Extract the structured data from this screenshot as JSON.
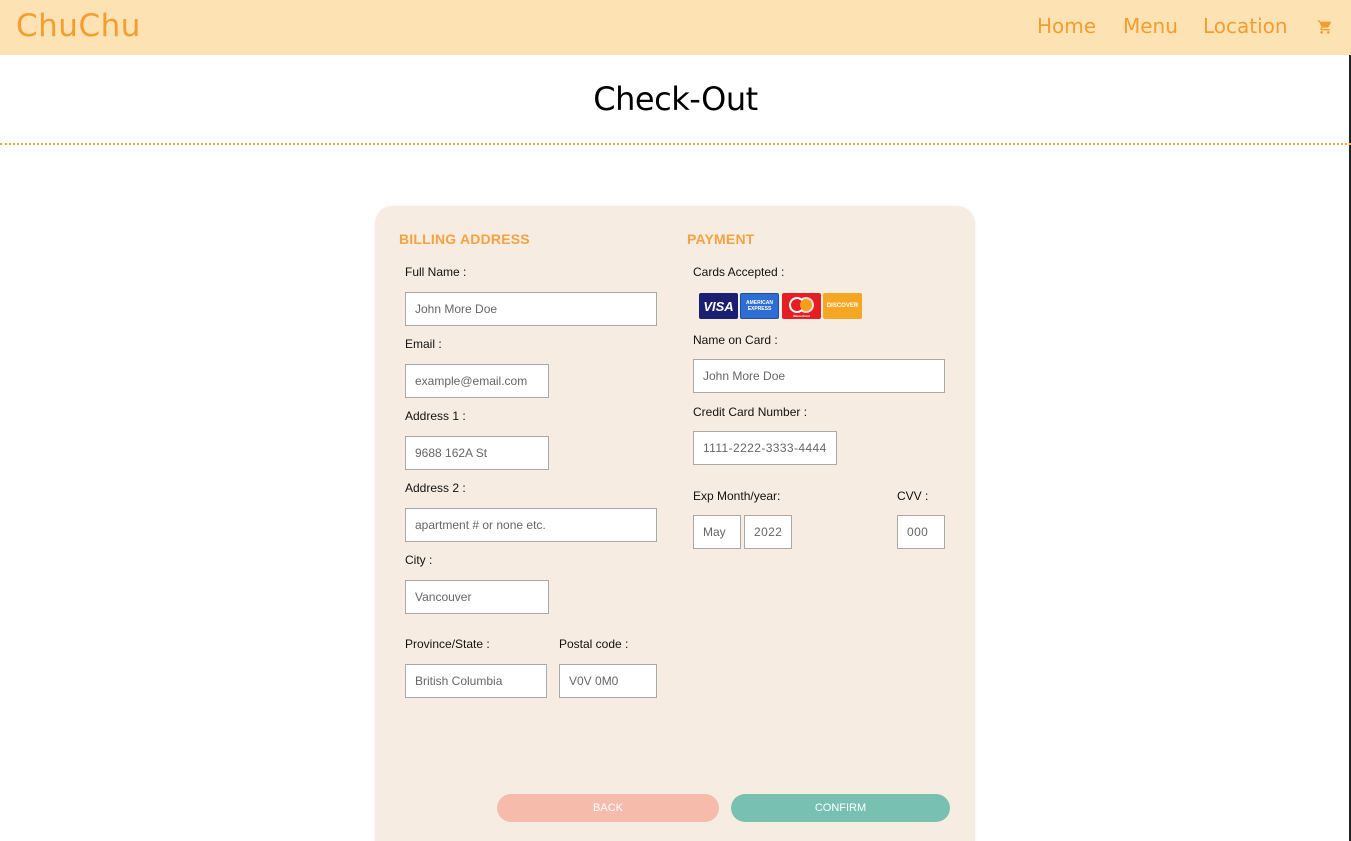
{
  "brand": {
    "name": "ChuChu",
    "color": "#f59d2e"
  },
  "nav": {
    "items": [
      "Home",
      "Menu",
      "Location"
    ],
    "cart_icon": "shopping-cart-icon",
    "background": "#fde3b3"
  },
  "page": {
    "title": "Check-Out"
  },
  "billing": {
    "heading": "BILLING ADDRESS",
    "full_name_label": "Full Name :",
    "full_name_placeholder": "John More Doe",
    "email_label": "Email :",
    "email_placeholder": "example@email.com",
    "address1_label": "Address 1 :",
    "address1_placeholder": "9688 162A St",
    "address2_label": "Address 2 :",
    "address2_placeholder": "apartment # or none etc.",
    "city_label": "City :",
    "city_placeholder": "Vancouver",
    "province_label": "Province/State :",
    "province_placeholder": "British Columbia",
    "postal_label": "Postal code :",
    "postal_placeholder": "V0V 0M0"
  },
  "payment": {
    "heading": "PAYMENT",
    "cards_label": "Cards Accepted :",
    "cards": [
      "VISA",
      "AMERICAN EXPRESS",
      "MasterCard",
      "DISCOVER"
    ],
    "name_label": "Name on Card :",
    "name_placeholder": "John More Doe",
    "card_number_label": "Credit Card Number :",
    "card_number_placeholder": "1111-2222-3333-4444",
    "exp_label": "Exp Month/year:",
    "exp_month_placeholder": "May",
    "exp_year_placeholder": "2022",
    "cvv_label": "CVV :",
    "cvv_placeholder": "000"
  },
  "actions": {
    "back_label": "BACK",
    "confirm_label": "CONFIRM",
    "back_color": "#f6bbab",
    "confirm_color": "#78c0b2"
  },
  "colors": {
    "accent": "#f59d2e",
    "card_background": "#f7ece2",
    "heading": "#f4a340"
  }
}
